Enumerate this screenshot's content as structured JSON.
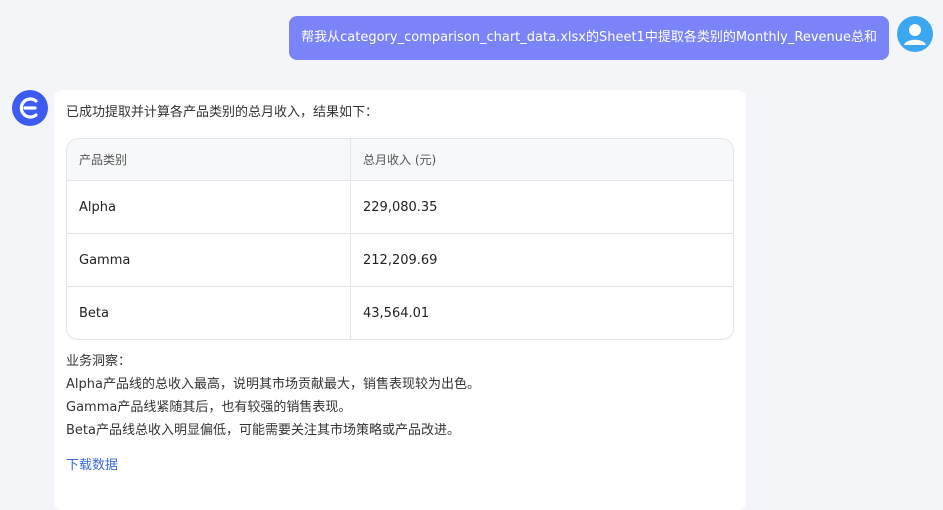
{
  "user_message": "帮我从category_comparison_chart_data.xlsx的Sheet1中提取各类别的Monthly_Revenue总和",
  "bot": {
    "intro": "已成功提取并计算各产品类别的总月收入，结果如下：",
    "table": {
      "headers": [
        "产品类别",
        "总月收入 (元)"
      ],
      "rows": [
        {
          "category": "Alpha",
          "revenue": "229,080.35"
        },
        {
          "category": "Gamma",
          "revenue": "212,209.69"
        },
        {
          "category": "Beta",
          "revenue": "43,564.01"
        }
      ]
    },
    "insights_title": "业务洞察：",
    "insights": [
      "Alpha产品线的总收入最高，说明其市场贡献最大，销售表现较为出色。",
      "Gamma产品线紧随其后，也有较强的销售表现。",
      "Beta产品线总收入明显偏低，可能需要关注其市场策略或产品改进。"
    ],
    "download_label": "下载数据"
  },
  "colors": {
    "user_bubble": "#7a83f7",
    "user_avatar": "#3aa7f0",
    "bot_avatar": "#3d5bf0",
    "link": "#3d6ad6"
  },
  "icons": {
    "user_avatar": "person-icon",
    "bot_avatar": "brand-e-icon"
  }
}
